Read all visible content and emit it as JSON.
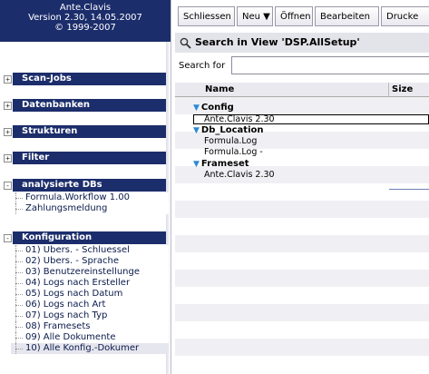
{
  "header": {
    "app_name": "Ante.Clavis",
    "version": "Version 2.30, 14.05.2007",
    "copyright": "© 1999-2007"
  },
  "sections": [
    {
      "label": "Scan-Jobs",
      "state": "+"
    },
    {
      "label": "Datenbanken",
      "state": "+"
    },
    {
      "label": "Strukturen",
      "state": "+"
    },
    {
      "label": "Filter",
      "state": "+"
    },
    {
      "label": "analysierte DBs",
      "state": "-",
      "items": [
        "Formula.Workflow 1.00",
        "Zahlungsmeldung"
      ]
    },
    {
      "label": "Konfiguration",
      "state": "-",
      "items": [
        "01) Übers. - Schluessel",
        "02) Übers. - Sprache",
        "03) Benutzereinstellunge",
        "04) Logs nach Ersteller",
        "05) Logs nach Datum",
        "06) Logs nach Art",
        "07) Logs nach Typ",
        "08) Framesets",
        "09) Alle Dokumente",
        "10) Alle Konfig.-Dokumer"
      ]
    }
  ],
  "toolbar": {
    "buttons": [
      "Schliessen",
      "Neu ▼",
      "Öffnen",
      "Bearbeiten",
      "Drucke"
    ]
  },
  "view": {
    "title": "Search in View 'DSP.AllSetup'",
    "search_label": "Search for",
    "search_value": ""
  },
  "grid": {
    "columns": [
      "Name",
      "Size"
    ],
    "categories": [
      {
        "name": "Config",
        "docs": [
          "Ante.Clavis 2.30"
        ]
      },
      {
        "name": "Db_Location",
        "docs": [
          "Formula.Log",
          "Formula.Log -"
        ]
      },
      {
        "name": "Frameset",
        "docs": [
          "Ante.Clavis 2.30"
        ]
      }
    ]
  },
  "colors": {
    "nav_blue": "#1c2d6b",
    "header_gray": "#e3e3ea",
    "stripe": "#f0f0f4",
    "tri_blue": "#2b8ad8"
  }
}
